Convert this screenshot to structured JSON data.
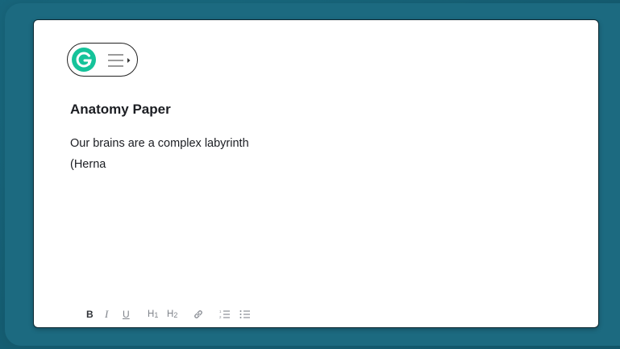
{
  "grammarly": {
    "logo_icon": "grammarly-g-icon",
    "menu_icon": "menu-expand-icon",
    "brand_color": "#15c39a"
  },
  "document": {
    "title": "Anatomy Paper",
    "lines": [
      "Our brains are a complex labyrinth",
      "(Herna"
    ]
  },
  "toolbar": {
    "bold": "B",
    "italic": "I",
    "underline": "U",
    "h1": "H",
    "h1_sub": "1",
    "h2": "H",
    "h2_sub": "2",
    "link_icon": "link-icon",
    "ordered_list_icon": "ordered-list-icon",
    "bullet_list_icon": "bullet-list-icon"
  },
  "colors": {
    "background": "#17647a",
    "card": "#ffffff",
    "text": "#1b1d22",
    "toolbar_icon": "#7f838a"
  }
}
